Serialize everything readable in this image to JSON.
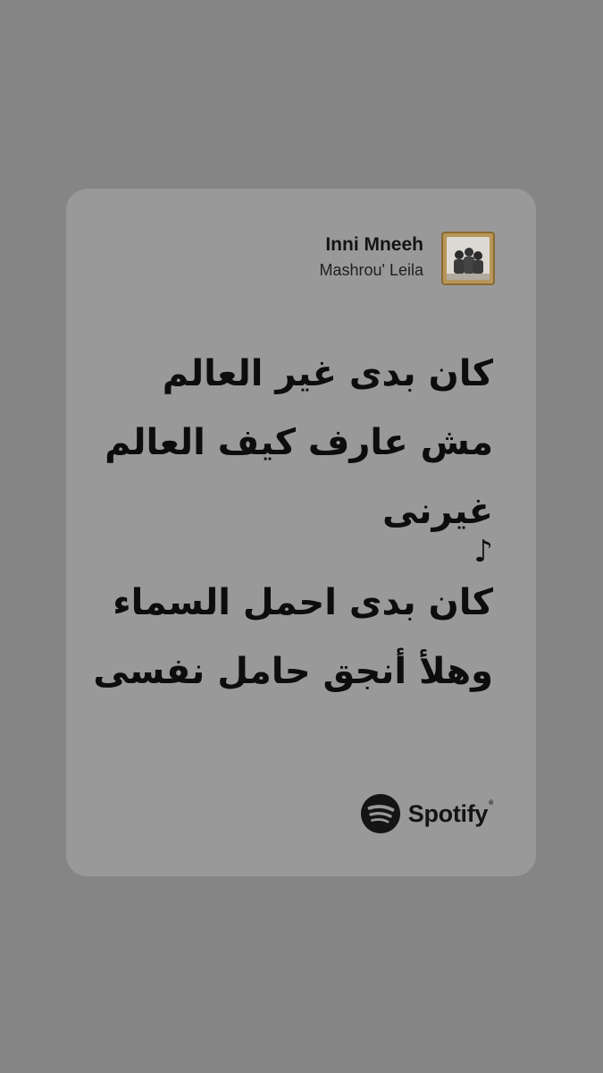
{
  "track": {
    "title": "Inni Mneeh",
    "artist": "Mashrou' Leila"
  },
  "lyrics": [
    "كان بدى غير العالم",
    "مش عارف كيف العالم",
    "غيرنى",
    "♪",
    "كان بدى احمل السماء",
    "وهلأ أنجق حامل نفسى"
  ],
  "brand": {
    "name": "Spotify",
    "trademark": "®",
    "icon": "spotify-logo-icon"
  },
  "colors": {
    "background": "#858585",
    "card": "#999999",
    "text": "#0d0d0d"
  }
}
